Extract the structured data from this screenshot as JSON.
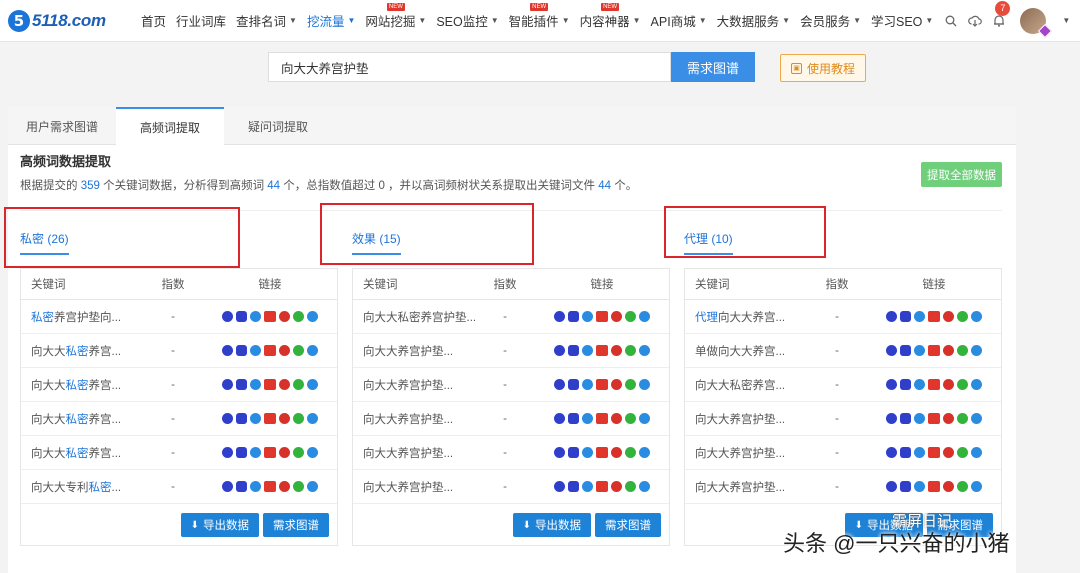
{
  "logo": {
    "mark": "5",
    "text": "5118.com"
  },
  "nav": [
    {
      "label": "首页",
      "caret": false,
      "new": false,
      "active": false
    },
    {
      "label": "行业词库",
      "caret": false,
      "new": false,
      "active": false
    },
    {
      "label": "查排名词",
      "caret": true,
      "new": false,
      "active": false
    },
    {
      "label": "挖流量",
      "caret": true,
      "new": false,
      "active": true
    },
    {
      "label": "网站挖掘",
      "caret": true,
      "new": true,
      "active": false
    },
    {
      "label": "SEO监控",
      "caret": true,
      "new": false,
      "active": false
    },
    {
      "label": "智能插件",
      "caret": true,
      "new": true,
      "active": false
    },
    {
      "label": "内容神器",
      "caret": true,
      "new": true,
      "active": false
    },
    {
      "label": "API商城",
      "caret": true,
      "new": false,
      "active": false
    },
    {
      "label": "大数据服务",
      "caret": true,
      "new": false,
      "active": false
    },
    {
      "label": "会员服务",
      "caret": true,
      "new": false,
      "active": false
    },
    {
      "label": "学习SEO",
      "caret": true,
      "new": false,
      "active": false
    }
  ],
  "new_badge": "NEW",
  "notifications": "7",
  "search": {
    "value": "向大大养宫护垫",
    "button": "需求图谱"
  },
  "tutorial": "使用教程",
  "tabs": [
    "用户需求图谱",
    "高频词提取",
    "疑问词提取"
  ],
  "section": {
    "title": "高频词数据提取",
    "desc_a": "根据提交的 ",
    "keywords": "359",
    "desc_b": " 个关键词数据，分析得到高频词 ",
    "highfreq": "44",
    "desc_c": " 个，总指数值超过 0 ，并以高词频树状关系提取出关键词文件 ",
    "files": "44",
    "desc_d": " 个。",
    "extract_button": "提取全部数据"
  },
  "table_headers": {
    "keyword": "关键词",
    "index": "指数",
    "links": "链接"
  },
  "groups": [
    {
      "title": "私密 (26)",
      "rows": [
        {
          "hl": "私密",
          "rest": "养宫护垫向...",
          "pre": "",
          "index": "-"
        },
        {
          "pre": "向大大",
          "hl": "私密",
          "rest": "养宫...",
          "index": "-"
        },
        {
          "pre": "向大大",
          "hl": "私密",
          "rest": "养宫...",
          "index": "-"
        },
        {
          "pre": "向大大",
          "hl": "私密",
          "rest": "养宫...",
          "index": "-"
        },
        {
          "pre": "向大大",
          "hl": "私密",
          "rest": "养宫...",
          "index": "-"
        },
        {
          "pre": "向大大专利",
          "hl": "私密",
          "rest": "...",
          "index": "-"
        }
      ],
      "export": "导出数据",
      "graph": "需求图谱"
    },
    {
      "title": "效果 (15)",
      "rows": [
        {
          "pre": "向大大私密养宫护垫...",
          "hl": "",
          "rest": "",
          "index": "-"
        },
        {
          "pre": "向大大养宫护垫...",
          "hl": "",
          "rest": "",
          "index": "-"
        },
        {
          "pre": "向大大养宫护垫...",
          "hl": "",
          "rest": "",
          "index": "-"
        },
        {
          "pre": "向大大养宫护垫...",
          "hl": "",
          "rest": "",
          "index": "-"
        },
        {
          "pre": "向大大养宫护垫...",
          "hl": "",
          "rest": "",
          "index": "-"
        },
        {
          "pre": "向大大养宫护垫...",
          "hl": "",
          "rest": "",
          "index": "-"
        }
      ],
      "export": "导出数据",
      "graph": "需求图谱"
    },
    {
      "title": "代理 (10)",
      "rows": [
        {
          "pre": "",
          "hl": "代理",
          "rest": "向大大养宫...",
          "index": "-"
        },
        {
          "pre": "单做向大大养宫...",
          "hl": "",
          "rest": "",
          "index": "-"
        },
        {
          "pre": "向大大私密养宫...",
          "hl": "",
          "rest": "",
          "index": "-"
        },
        {
          "pre": "向大大养宫护垫...",
          "hl": "",
          "rest": "",
          "index": "-"
        },
        {
          "pre": "向大大养宫护垫...",
          "hl": "",
          "rest": "",
          "index": "-"
        },
        {
          "pre": "向大大养宫护垫...",
          "hl": "",
          "rest": "",
          "index": "-"
        }
      ],
      "export": "导出数据",
      "graph": "需求图谱"
    }
  ],
  "link_icons": [
    "baidu-icon",
    "baidu-mobile-icon",
    "360-icon",
    "news-icon",
    "weibo-icon",
    "wechat-icon",
    "zhihu-icon"
  ],
  "watermark": {
    "main": "头条 @一只兴奋的小猪",
    "secondary": "霸屏日记"
  },
  "colors": {
    "accent": "#3a8ee6",
    "highlight": "#1d74d8",
    "red_box": "#d9262b",
    "green_button": "#6fcf7b"
  }
}
